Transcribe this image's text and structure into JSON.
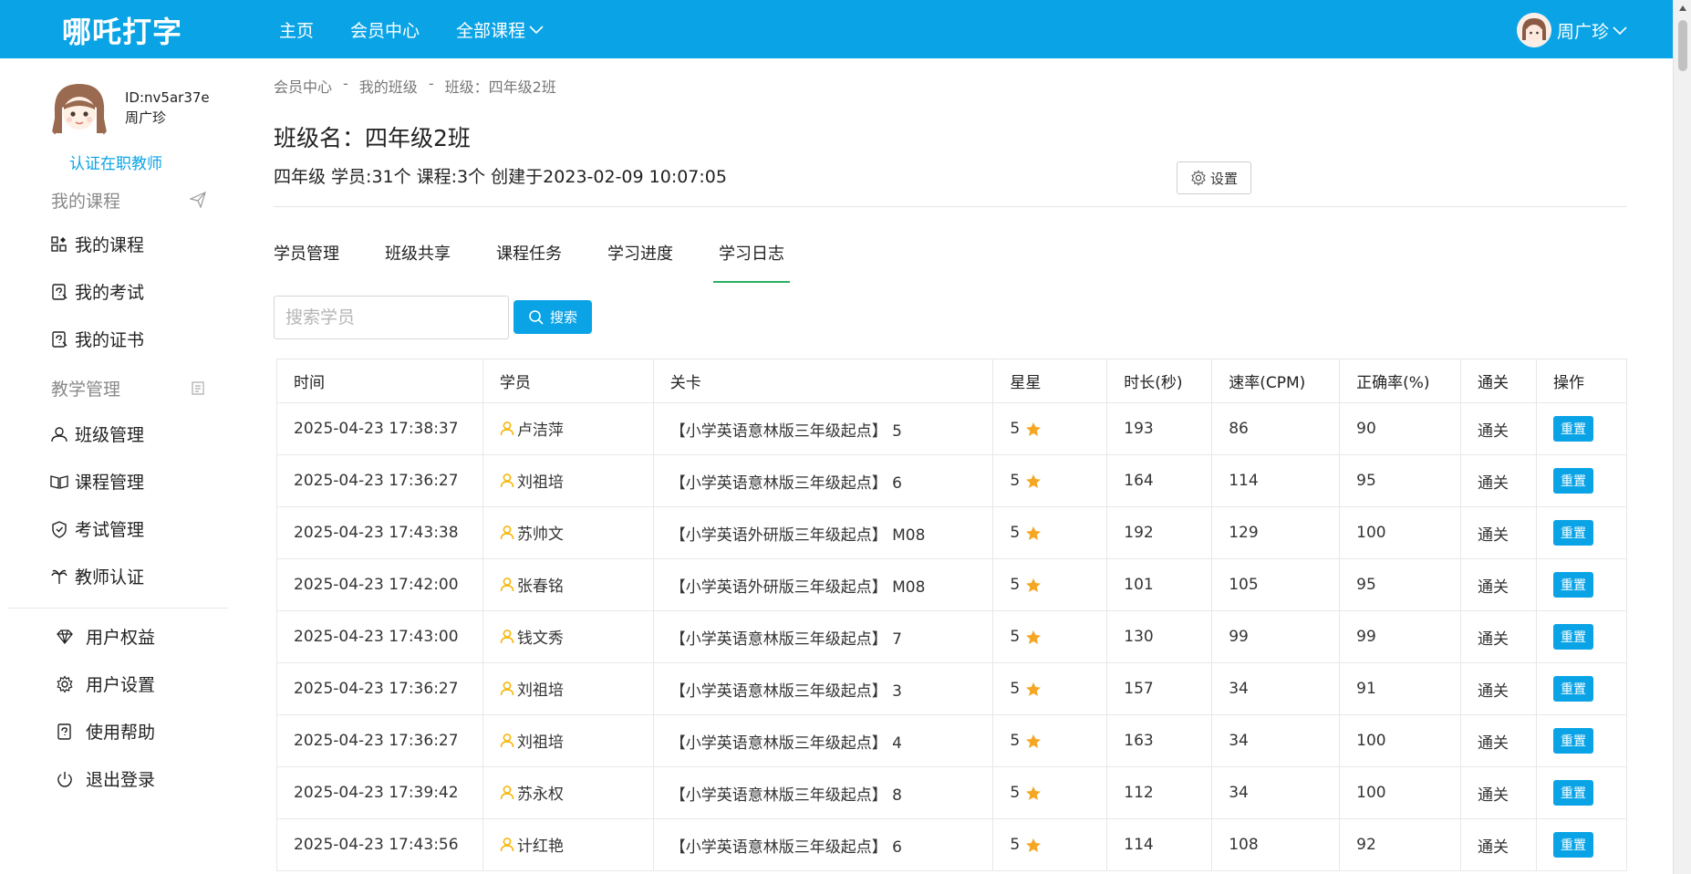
{
  "header": {
    "logo": "哪吒打字",
    "nav": [
      {
        "label": "主页"
      },
      {
        "label": "会员中心"
      },
      {
        "label": "全部课程"
      }
    ],
    "user_name": "周广珍"
  },
  "sidebar": {
    "profile": {
      "id": "ID:nv5ar37e",
      "name": "周广珍",
      "certify": "认证在职教师"
    },
    "section1_title": "我的课程",
    "section1_items": [
      {
        "label": "我的课程"
      },
      {
        "label": "我的考试"
      },
      {
        "label": "我的证书"
      }
    ],
    "section2_title": "教学管理",
    "section2_items": [
      {
        "label": "班级管理"
      },
      {
        "label": "课程管理"
      },
      {
        "label": "考试管理"
      },
      {
        "label": "教师认证"
      }
    ],
    "bottom_items": [
      {
        "label": "用户权益"
      },
      {
        "label": "用户设置"
      },
      {
        "label": "使用帮助"
      },
      {
        "label": "退出登录"
      }
    ]
  },
  "breadcrumb": [
    "会员中心",
    "我的班级",
    "班级：四年级2班"
  ],
  "class_title": "班级名：四年级2班",
  "class_meta": "四年级 学员:31个 课程:3个 创建于2023-02-09 10:07:05",
  "settings_label": "设置",
  "tabs": [
    {
      "label": "学员管理"
    },
    {
      "label": "班级共享"
    },
    {
      "label": "课程任务"
    },
    {
      "label": "学习进度"
    },
    {
      "label": "学习日志"
    }
  ],
  "active_tab": "学习日志",
  "search": {
    "placeholder": "搜索学员",
    "button": "搜索"
  },
  "table": {
    "headers": [
      "时间",
      "学员",
      "关卡",
      "星星",
      "时长(秒)",
      "速率(CPM)",
      "正确率(%)",
      "通关",
      "操作"
    ],
    "rows": [
      {
        "time": "2025-04-23 17:38:37",
        "student": "卢洁萍",
        "level": "【小学英语意林版三年级起点】 5",
        "stars": "5",
        "duration": "193",
        "cpm": "86",
        "accuracy": "90",
        "pass": "通关",
        "action": "重置"
      },
      {
        "time": "2025-04-23 17:36:27",
        "student": "刘祖培",
        "level": "【小学英语意林版三年级起点】 6",
        "stars": "5",
        "duration": "164",
        "cpm": "114",
        "accuracy": "95",
        "pass": "通关",
        "action": "重置"
      },
      {
        "time": "2025-04-23 17:43:38",
        "student": "苏帅文",
        "level": "【小学英语外研版三年级起点】 M08",
        "stars": "5",
        "duration": "192",
        "cpm": "129",
        "accuracy": "100",
        "pass": "通关",
        "action": "重置"
      },
      {
        "time": "2025-04-23 17:42:00",
        "student": "张春铭",
        "level": "【小学英语外研版三年级起点】 M08",
        "stars": "5",
        "duration": "101",
        "cpm": "105",
        "accuracy": "95",
        "pass": "通关",
        "action": "重置"
      },
      {
        "time": "2025-04-23 17:43:00",
        "student": "钱文秀",
        "level": "【小学英语意林版三年级起点】 7",
        "stars": "5",
        "duration": "130",
        "cpm": "99",
        "accuracy": "99",
        "pass": "通关",
        "action": "重置"
      },
      {
        "time": "2025-04-23 17:36:27",
        "student": "刘祖培",
        "level": "【小学英语意林版三年级起点】 3",
        "stars": "5",
        "duration": "157",
        "cpm": "34",
        "accuracy": "91",
        "pass": "通关",
        "action": "重置"
      },
      {
        "time": "2025-04-23 17:36:27",
        "student": "刘祖培",
        "level": "【小学英语意林版三年级起点】 4",
        "stars": "5",
        "duration": "163",
        "cpm": "34",
        "accuracy": "100",
        "pass": "通关",
        "action": "重置"
      },
      {
        "time": "2025-04-23 17:39:42",
        "student": "苏永权",
        "level": "【小学英语意林版三年级起点】 8",
        "stars": "5",
        "duration": "112",
        "cpm": "34",
        "accuracy": "100",
        "pass": "通关",
        "action": "重置"
      },
      {
        "time": "2025-04-23 17:43:56",
        "student": "计红艳",
        "level": "【小学英语意林版三年级起点】 6",
        "stars": "5",
        "duration": "114",
        "cpm": "108",
        "accuracy": "92",
        "pass": "通关",
        "action": "重置"
      }
    ]
  },
  "colors": {
    "primary": "#0aa4e6",
    "tab_underline": "#27b062",
    "star": "#f5a623",
    "student_icon": "#f5b301"
  }
}
